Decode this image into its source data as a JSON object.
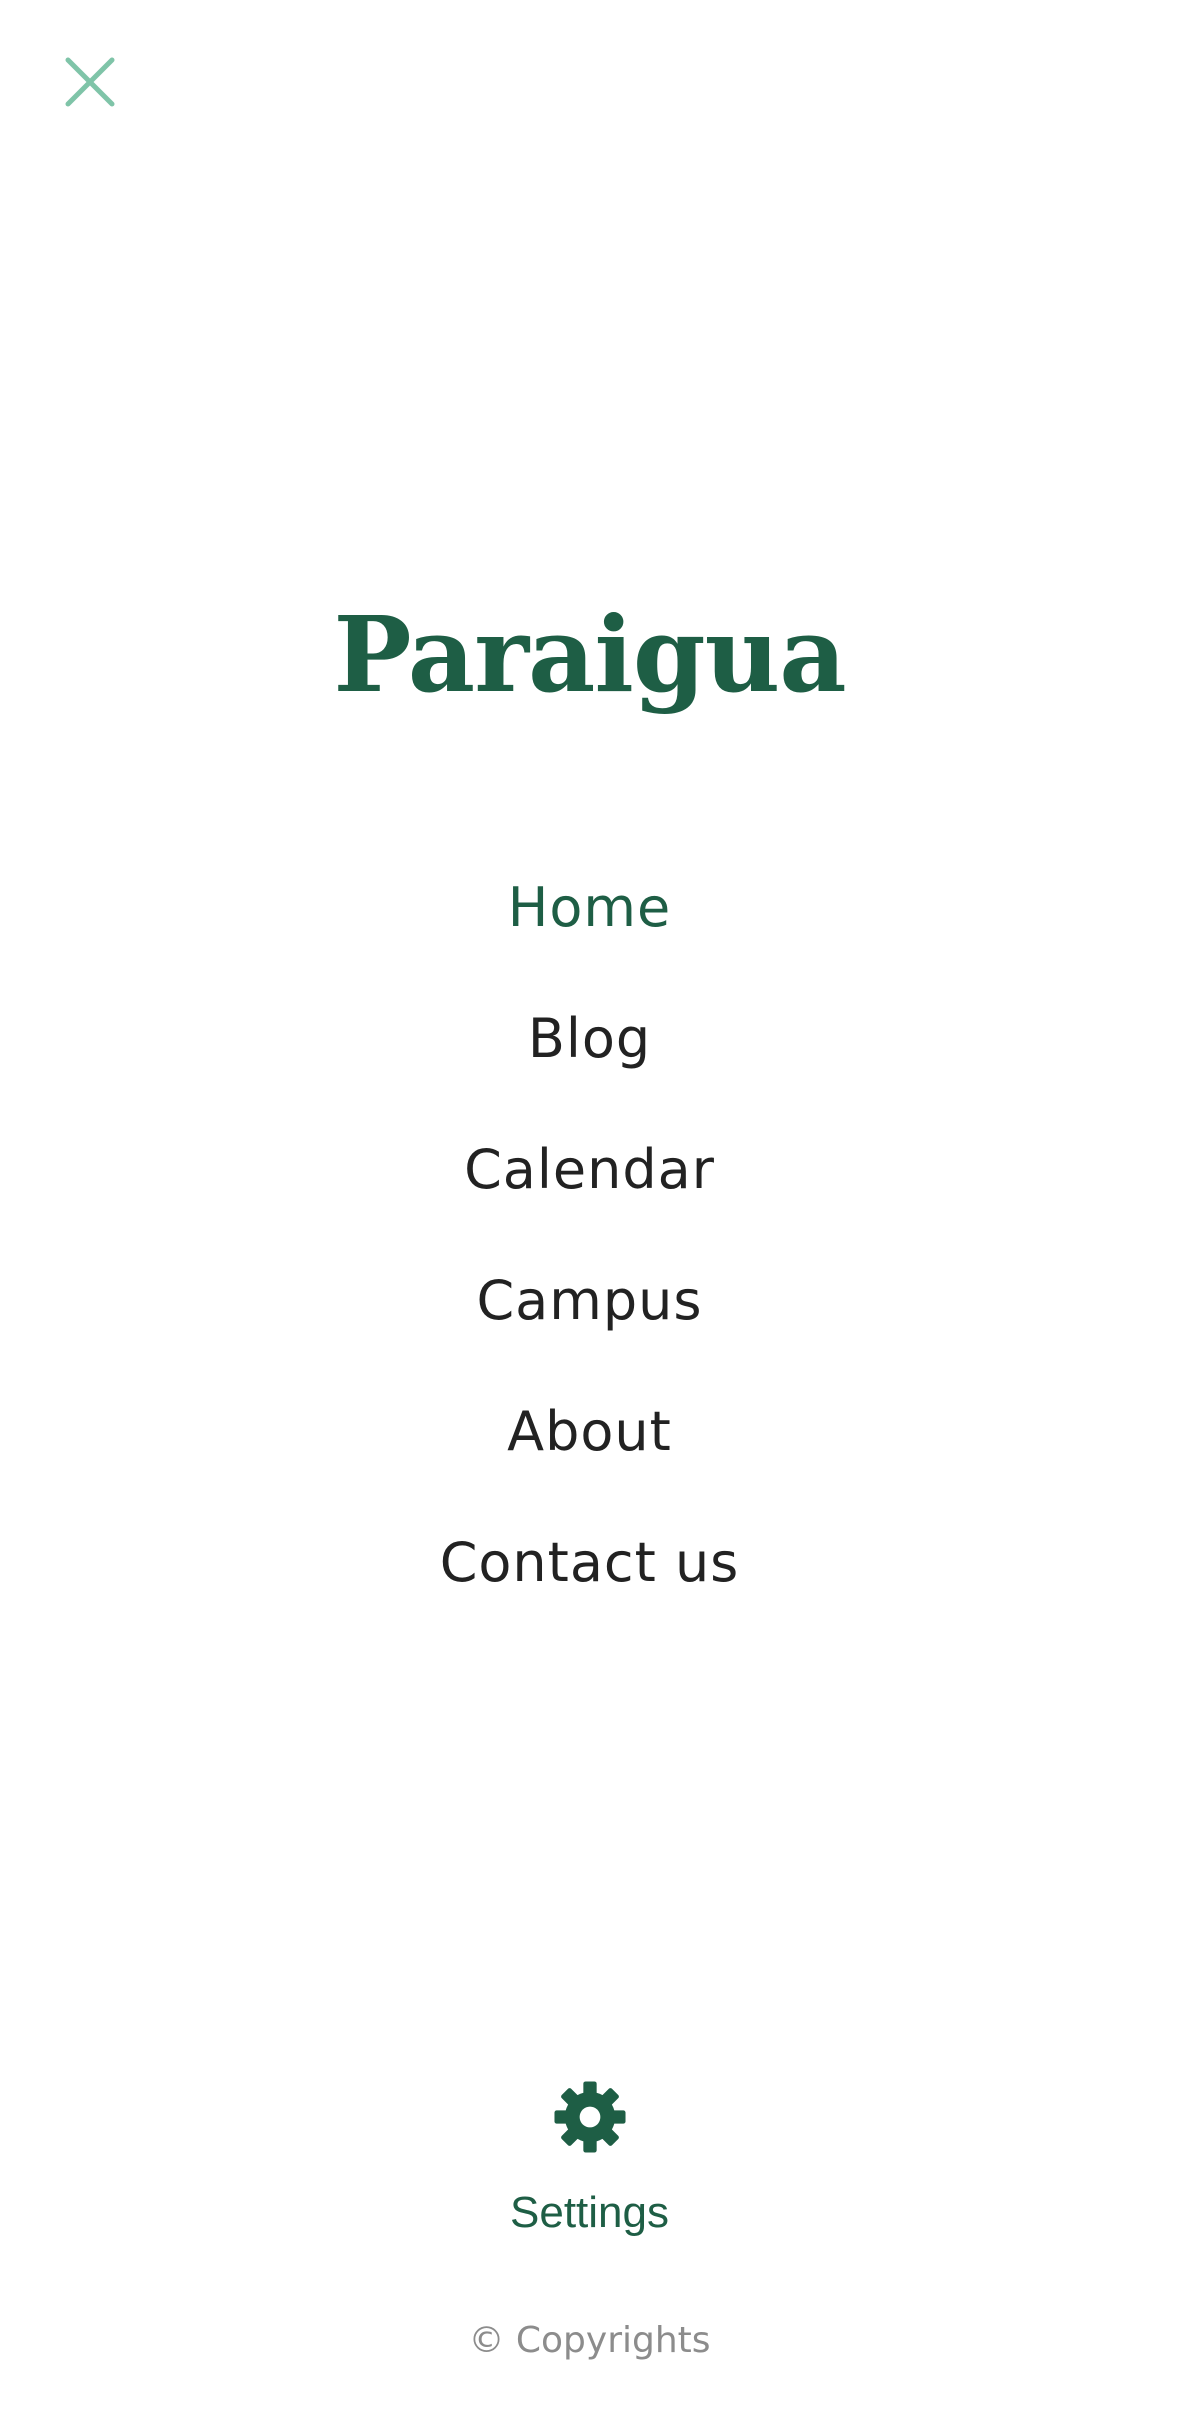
{
  "header": {
    "close_icon": "close-icon",
    "close_color": "#7fc4a8"
  },
  "brand": {
    "name": "Paraigua",
    "color": "#1e5e45"
  },
  "nav": {
    "items": [
      {
        "label": "Home",
        "active": true
      },
      {
        "label": "Blog",
        "active": false
      },
      {
        "label": "Calendar",
        "active": false
      },
      {
        "label": "Campus",
        "active": false
      },
      {
        "label": "About",
        "active": false
      },
      {
        "label": "Contact us",
        "active": false
      }
    ],
    "active_color": "#1e5e45",
    "text_color": "#222222"
  },
  "settings": {
    "icon": "gear-icon",
    "label": "Settings"
  },
  "footer": {
    "copyright": "© Copyrights"
  }
}
